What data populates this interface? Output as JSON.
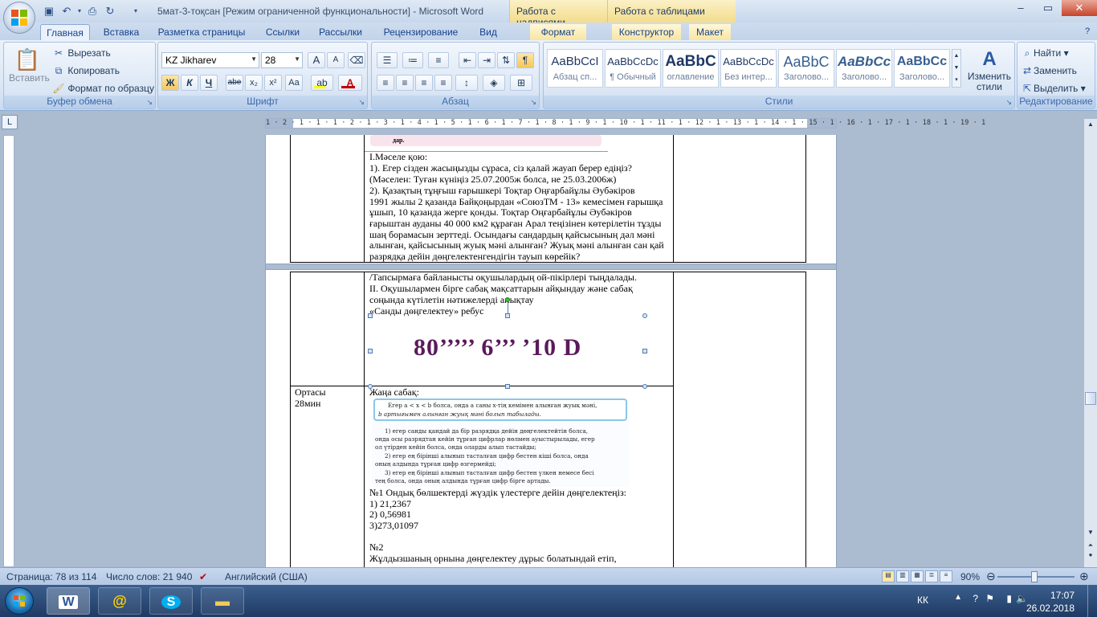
{
  "window": {
    "title": "5мат-3-тоқсан [Режим ограниченной функциональности] - Microsoft Word",
    "context_heads": [
      "Работа с надписями",
      "Работа с таблицами"
    ]
  },
  "tabs": [
    "Главная",
    "Вставка",
    "Разметка страницы",
    "Ссылки",
    "Рассылки",
    "Рецензирование",
    "Вид",
    "Формат",
    "Конструктор",
    "Макет"
  ],
  "clipboard": {
    "paste": "Вставить",
    "cut": "Вырезать",
    "copy": "Копировать",
    "format_painter": "Формат по образцу",
    "label": "Буфер обмена"
  },
  "font": {
    "name": "KZ Jikharev",
    "size": "28",
    "label": "Шрифт",
    "bold": "Ж",
    "italic": "К",
    "underline": "Ч",
    "strike": "abe",
    "sub": "x₂",
    "sup": "x²",
    "case": "Aa",
    "grow": "A",
    "shrink": "A"
  },
  "paragraph": {
    "label": "Абзац"
  },
  "styles": {
    "label": "Стили",
    "items": [
      {
        "preview": "AaBbCcI",
        "name": "Абзац сп..."
      },
      {
        "preview": "AaBbCcDc",
        "name": "¶ Обычный"
      },
      {
        "preview": "AaBbC",
        "name": "оглавление"
      },
      {
        "preview": "AaBbCcDc",
        "name": "Без интер..."
      },
      {
        "preview": "AaBbC",
        "name": "Заголово..."
      },
      {
        "preview": "AaBbCc",
        "name": "Заголово..."
      },
      {
        "preview": "AaBbCc",
        "name": "Заголово..."
      }
    ],
    "change_styles": "Изменить стили"
  },
  "editing": {
    "label": "Редактирование",
    "find": "Найти",
    "replace": "Заменить",
    "select": "Выделить"
  },
  "ruler_text": "1 · 2 · 1 · 1 · 1 · 2 · 1 · 3 · 1 · 4 · 1 · 5 · 1 · 6 · 1 · 7 · 1 · 8 · 1 · 9 · 1 · 10 · 1 · 11 · 1 · 12 · 1 · 13 · 1 · 14 · 1 · 15 · 1 · 16 · 1 · 17 · 1 · 18 · 1 · 19 · 1",
  "doc": {
    "top_image_text": "дар.",
    "upper_lines": [
      "І.Мәселе қою:",
      "1). Егер  сізден  жасыңызды сұраса, сіз қалай жауап берер едіңіз?",
      "  (Мәселен: Туған күніңіз 25.07.2005ж болса, не  25.03.2006ж)",
      "2).  Қазақтың тұңғыш ғарышкері Тоқтар Оңғарбайұлы Әубәкіров",
      "1991 жылы 2 қазанда Байқоңырдан «СоюзТМ - 13» кемесімен ғарышқа",
      "ұшып, 10 қазанда жерге қонды. Тоқтар Оңғарбайұлы Әубәкіров",
      "ғарыштан ауданы 40 000 км2 құраған Арал теңізінен  көтерілетін тұзды",
      "шаң борамасын зерттеді. Осындағы сандардың қайсысының дәл мәні",
      "алынған, қайсысының жуық мәні алынған? Жуық мәні алынған сан қай",
      "разрядқа дейін дөңгелектенгендігін  тауып көрейік?"
    ],
    "middle_lines": [
      "/Тапсырмаға байланысты  оқушылардың ой-пікірлері тыңдалады.",
      "ІІ. Оқушылармен бірге сабақ мақсаттарын айқындау және сабақ",
      "соңында күтілетін нәтижелерді  анықтау",
      "«Санды дөңгелектеу» ребус"
    ],
    "rebus": "80’’’’’  6’’’  ’10  D",
    "left_cell": [
      "Ортасы",
      "28мин"
    ],
    "new_lesson": "Жаңа сабақ:",
    "image_rule_lines": [
      "Егер a < x < b болса, онда a саны x-тің кемімен алынған жуық мәні,",
      "b артығымен алынған жуық мәні болып табылады."
    ],
    "image_body_lines": [
      "1) егер санды қандай да бір разрядқа дейін дөңгелектейтін болса,",
      "онда осы разрядтан кейін тұрған цифрлар нөлмен ауыстырылады, егер",
      "ол үтірден кейін болса, онда оларды алып тастайды;",
      "2) егер ең бірінші алынып тасталған цифр бестен кіші болса, онда",
      "оның алдында тұрған цифр өзгермейді;",
      "3) егер ең бірінші алынып тасталған цифр бестен үлкен немесе бесі",
      "тең болса, онда оның алдында тұрған цифр бірге артады."
    ],
    "task_lines": [
      "№1 Ондық бөлшектерді жүздік үлестерге дейін дөңгелектеңіз:",
      "1) 21,2367",
      "2) 0,56981",
      "3)273,01097",
      "",
      "№2",
      "Жұлдызшаның орнына дөңгелектеу дұрыс болатындай етіп,"
    ]
  },
  "status": {
    "page": "Страница: 78 из 114",
    "words": "Число слов: 21 940",
    "language": "Английский (США)",
    "zoom": "90%"
  },
  "taskbar": {
    "lang": "КК",
    "time": "17:07",
    "date": "26.02.2018"
  }
}
